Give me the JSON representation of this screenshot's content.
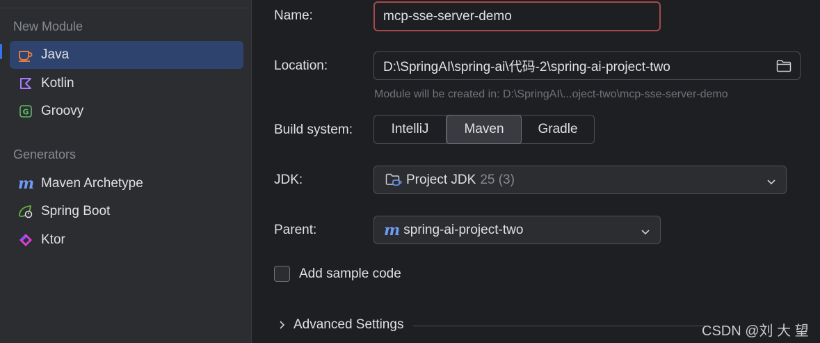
{
  "sidebar": {
    "section_new_module": "New Module",
    "section_generators": "Generators",
    "modules": [
      {
        "label": "Java",
        "icon": "java-cup-icon",
        "selected": true
      },
      {
        "label": "Kotlin",
        "icon": "kotlin-icon",
        "selected": false
      },
      {
        "label": "Groovy",
        "icon": "groovy-icon",
        "selected": false
      }
    ],
    "generators": [
      {
        "label": "Maven Archetype",
        "icon": "maven-icon"
      },
      {
        "label": "Spring Boot",
        "icon": "spring-boot-icon"
      },
      {
        "label": "Ktor",
        "icon": "ktor-icon"
      }
    ]
  },
  "form": {
    "name_label": "Name:",
    "name_value": "mcp-sse-server-demo",
    "location_label": "Location:",
    "location_value": "D:\\SpringAI\\spring-ai\\代码-2\\spring-ai-project-two",
    "location_hint": "Module will be created in: D:\\SpringAI\\...oject-two\\mcp-sse-server-demo",
    "build_system_label": "Build system:",
    "build_systems": [
      "IntelliJ",
      "Maven",
      "Gradle"
    ],
    "build_system_selected": "Maven",
    "jdk_label": "JDK:",
    "jdk_value": "Project JDK",
    "jdk_version": "25 (3)",
    "parent_label": "Parent:",
    "parent_value": "spring-ai-project-two",
    "add_sample_code_label": "Add sample code",
    "add_sample_code_checked": false,
    "advanced_settings_label": "Advanced Settings"
  },
  "watermark": "CSDN @刘 大 望",
  "colors": {
    "background": "#1e1f22",
    "sidebar": "#2b2d30",
    "selection": "#2e436e",
    "error_border": "#a54a4a",
    "accent": "#3574f0"
  }
}
